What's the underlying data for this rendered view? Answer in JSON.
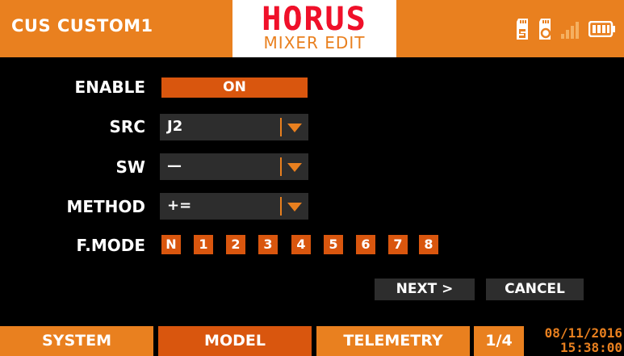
{
  "header": {
    "model_name": "CUS CUSTOM1",
    "logo_text": "HORUS",
    "page_title": "MIXER EDIT",
    "status_icons": [
      "sd-card-icon",
      "storage-icon",
      "signal-bars-icon",
      "battery-icon"
    ]
  },
  "form": {
    "enable": {
      "label": "ENABLE",
      "value": "ON"
    },
    "src": {
      "label": "SRC",
      "value": "J2"
    },
    "sw": {
      "label": "SW",
      "value": "—"
    },
    "method": {
      "label": "METHOD",
      "value": "+="
    },
    "fmode": {
      "label": "F.MODE",
      "modes": [
        "N",
        "1",
        "2",
        "3",
        "4",
        "5",
        "6",
        "7",
        "8"
      ]
    }
  },
  "buttons": {
    "next": "NEXT >",
    "cancel": "CANCEL"
  },
  "footer": {
    "tabs": [
      "SYSTEM",
      "MODEL",
      "TELEMETRY"
    ],
    "active_tab": "MODEL",
    "page_indicator": "1/4",
    "date": "08/11/2016",
    "time": "15:38:00"
  },
  "colors": {
    "accent": "#e9801f",
    "active": "#d9560e",
    "field_bg": "#2d2d2d",
    "logo_red": "#f0102a"
  }
}
